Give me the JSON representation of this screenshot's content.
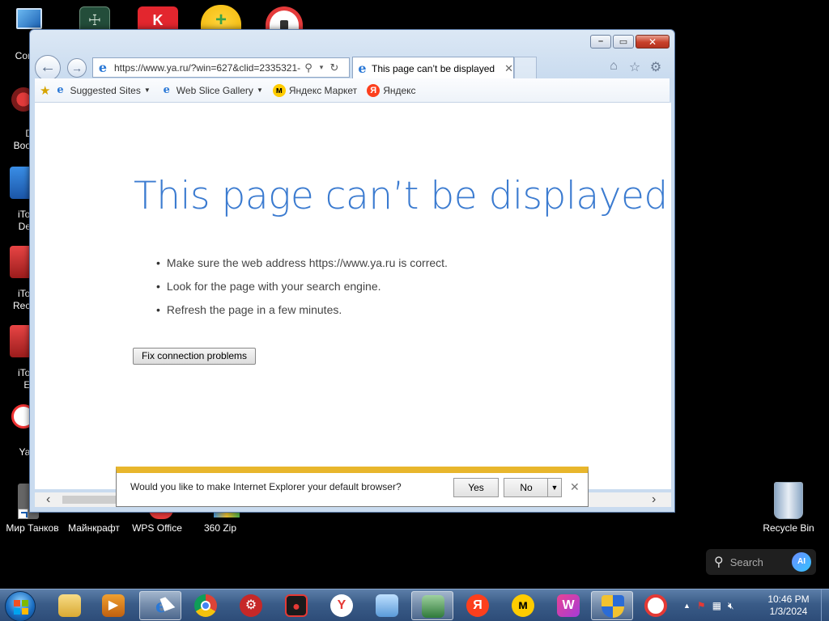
{
  "desktop": {
    "bottom_icons": [
      {
        "label": "Мир Танков"
      },
      {
        "label": "Майнкрафт"
      },
      {
        "label": "WPS Office"
      },
      {
        "label": "360 Zip"
      }
    ],
    "left_labels": {
      "computer": "Com",
      "driver_booster_1": "Dr",
      "driver_booster_2": "Boos",
      "itop_desk_1": "iTop",
      "itop_desk_2": "Des",
      "itop_rec_1": "iTop",
      "itop_rec_2": "Reco",
      "itop_edit_1": "iTop",
      "itop_edit_2": "Ed",
      "yandex": "Yan"
    },
    "recycle_bin": {
      "label": "Recycle Bin"
    },
    "search_widget": {
      "placeholder": "Search",
      "ai_label": "AI"
    }
  },
  "browser": {
    "address": "https://www.ya.ru/?win=627&clid=2335321-",
    "tab_title": "This page can’t be displayed",
    "favorites": [
      {
        "label": "Suggested Sites",
        "has_dropdown": true
      },
      {
        "label": "Web Slice Gallery",
        "has_dropdown": true
      },
      {
        "label": "Яндекс Маркет",
        "has_dropdown": false
      },
      {
        "label": "Яндекс",
        "has_dropdown": false
      }
    ],
    "error": {
      "title": "This page can’t be displayed",
      "suggestions": [
        "Make sure the web address https://www.ya.ru is correct.",
        "Look for the page with your search engine.",
        "Refresh the page in a few minutes."
      ],
      "fix_button": "Fix connection problems"
    },
    "notification": {
      "message": "Would you like to make Internet Explorer your default browser?",
      "yes": "Yes",
      "no": "No"
    }
  },
  "taskbar": {
    "clock_time": "10:46 PM",
    "clock_date": "1/3/2024"
  },
  "colors": {
    "error_title": "#3b7bd0",
    "notification_accent": "#e8b62c",
    "taskbar": "#3a5c88"
  }
}
